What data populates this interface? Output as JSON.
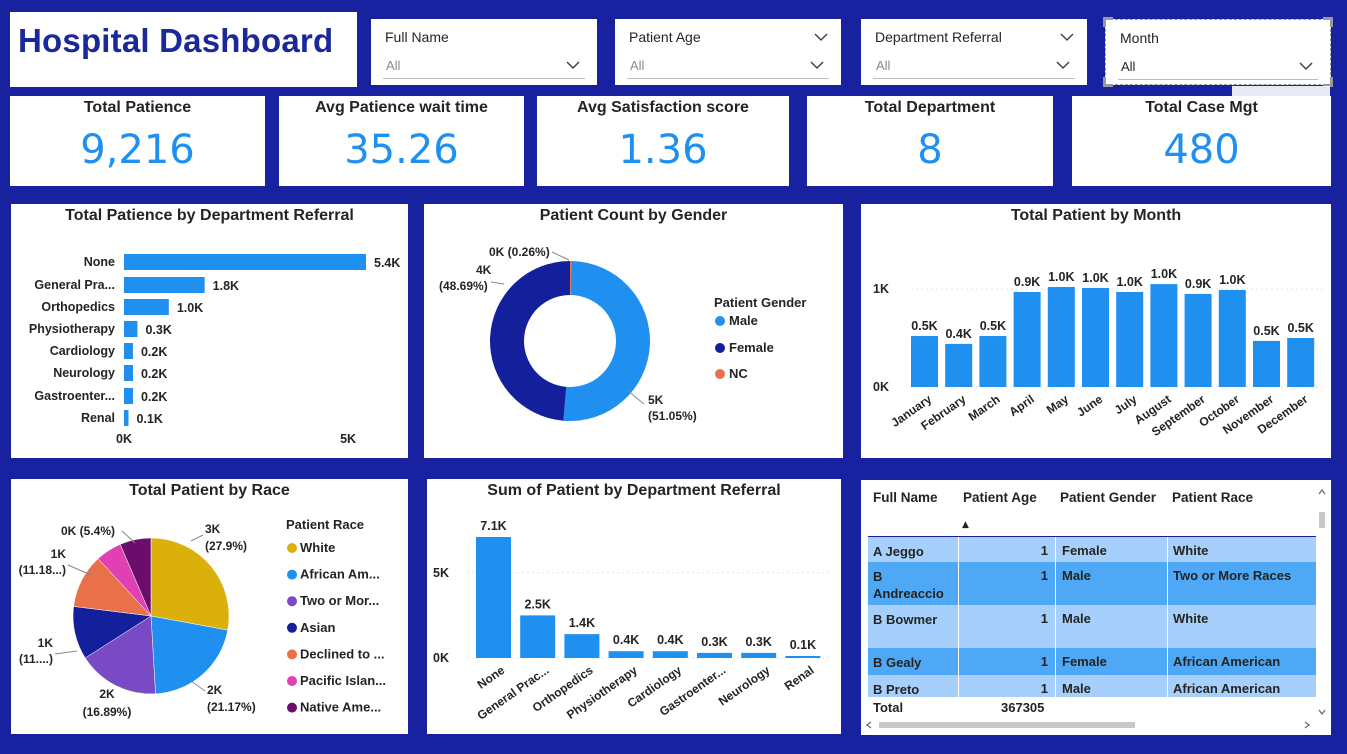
{
  "title": "Hospital Dashboard",
  "slicers": [
    {
      "label": "Full Name",
      "value": "All"
    },
    {
      "label": "Patient Age",
      "value": "All"
    },
    {
      "label": "Department Referral",
      "value": "All"
    },
    {
      "label": "Month",
      "value": "All"
    }
  ],
  "kpis": [
    {
      "label": "Total Patience",
      "value": "9,216"
    },
    {
      "label": "Avg Patience wait time",
      "value": "35.26"
    },
    {
      "label": "Avg Satisfaction score",
      "value": "1.36"
    },
    {
      "label": "Total Department",
      "value": "8"
    },
    {
      "label": "Total Case Mgt",
      "value": "480"
    }
  ],
  "colors": {
    "accent": "#1f8ff0",
    "background": "#1822a0",
    "title": "#1a2899",
    "female": "#131f9b",
    "nc": "#e8704a"
  },
  "chart_data": [
    {
      "type": "bar",
      "orientation": "horizontal",
      "title": "Total Patience by Department Referral",
      "categories": [
        "None",
        "General Pra...",
        "Orthopedics",
        "Physiotherapy",
        "Cardiology",
        "Neurology",
        "Gastroenter...",
        "Renal"
      ],
      "values": [
        5400,
        1800,
        1000,
        300,
        200,
        200,
        200,
        100
      ],
      "labels": [
        "5.4K",
        "1.8K",
        "1.0K",
        "0.3K",
        "0.2K",
        "0.2K",
        "0.2K",
        "0.1K"
      ],
      "xticks": [
        "0K",
        "5K"
      ],
      "xlim": [
        0,
        5400
      ]
    },
    {
      "type": "pie",
      "donut": true,
      "title": "Patient Count by Gender",
      "legend_title": "Patient Gender",
      "legend_position": "right",
      "series": [
        {
          "name": "Male",
          "value": 51.05,
          "label": "5K",
          "pct": "(51.05%)",
          "color": "#1f8ff0"
        },
        {
          "name": "Female",
          "value": 48.69,
          "label": "4K",
          "pct": "(48.69%)",
          "color": "#131f9b"
        },
        {
          "name": "NC",
          "value": 0.26,
          "label": "0K (0.26%)",
          "pct": "",
          "color": "#e8704a"
        }
      ]
    },
    {
      "type": "bar",
      "title": "Total Patient by Month",
      "categories": [
        "January",
        "February",
        "March",
        "April",
        "May",
        "June",
        "July",
        "August",
        "September",
        "October",
        "November",
        "December"
      ],
      "values": [
        500,
        400,
        500,
        900,
        1000,
        1000,
        900,
        1000,
        900,
        1000,
        500,
        500
      ],
      "heights": [
        0.52,
        0.44,
        0.52,
        0.97,
        1.02,
        1.01,
        0.97,
        1.05,
        0.95,
        0.99,
        0.47,
        0.5
      ],
      "labels": [
        "0.5K",
        "0.4K",
        "0.5K",
        "0.9K",
        "1.0K",
        "1.0K",
        "1.0K",
        "1.0K",
        "0.9K",
        "1.0K",
        "0.5K",
        "0.5K"
      ],
      "yticks": [
        "0K",
        "1K"
      ],
      "ylim": [
        0,
        1000
      ]
    },
    {
      "type": "pie",
      "title": "Total Patient by Race",
      "legend_title": "Patient Race",
      "legend_position": "right",
      "series": [
        {
          "name": "White",
          "value": 27.9,
          "label": "3K",
          "pct": "(27.9%)",
          "color": "#dcb00b"
        },
        {
          "name": "African Am...",
          "value": 21.17,
          "label": "2K",
          "pct": "(21.17%)",
          "color": "#1f8ff0"
        },
        {
          "name": "Two or Mor...",
          "value": 16.89,
          "label": "2K",
          "pct": "(16.89%)",
          "color": "#7a4ac4"
        },
        {
          "name": "Asian",
          "value": 11.0,
          "label": "1K",
          "pct": "(11....)",
          "color": "#131f9b"
        },
        {
          "name": "Declined to ...",
          "value": 11.18,
          "label": "1K",
          "pct": "(11.18...)",
          "color": "#e8704a"
        },
        {
          "name": "Pacific Islan...",
          "value": 5.4,
          "label": "0K (5.4%)",
          "pct": "",
          "color": "#e040b4"
        },
        {
          "name": "Native Ame...",
          "value": 6.46,
          "label": "",
          "pct": "",
          "color": "#6b0d6d"
        }
      ]
    },
    {
      "type": "bar",
      "title": "Sum of Patient by Department Referral",
      "categories": [
        "None",
        "General Prac...",
        "Orthopedics",
        "Physiotherapy",
        "Cardiology",
        "Gastroenter...",
        "Neurology",
        "Renal"
      ],
      "values": [
        7100,
        2500,
        1400,
        400,
        400,
        300,
        300,
        100
      ],
      "labels": [
        "7.1K",
        "2.5K",
        "1.4K",
        "0.4K",
        "0.4K",
        "0.3K",
        "0.3K",
        "0.1K"
      ],
      "yticks": [
        "0K",
        "5K"
      ],
      "ylim": [
        0,
        7100
      ]
    }
  ],
  "table": {
    "columns": [
      "Full Name",
      "Patient Age",
      "Patient Gender",
      "Patient Race"
    ],
    "sort_indicator": "▲",
    "rows": [
      {
        "name": "A Jeggo",
        "age": "1",
        "gender": "Female",
        "race": "White"
      },
      {
        "name": "B Andreaccio",
        "age": "1",
        "gender": "Male",
        "race": "Two or More Races"
      },
      {
        "name": "B Bowmer",
        "age": "1",
        "gender": "Male",
        "race": "White"
      },
      {
        "name": "B Gealy",
        "age": "1",
        "gender": "Female",
        "race": "African American"
      },
      {
        "name": "B Preto",
        "age": "1",
        "gender": "Male",
        "race": "African American"
      }
    ],
    "total_label": "Total",
    "total_value": "367305"
  }
}
